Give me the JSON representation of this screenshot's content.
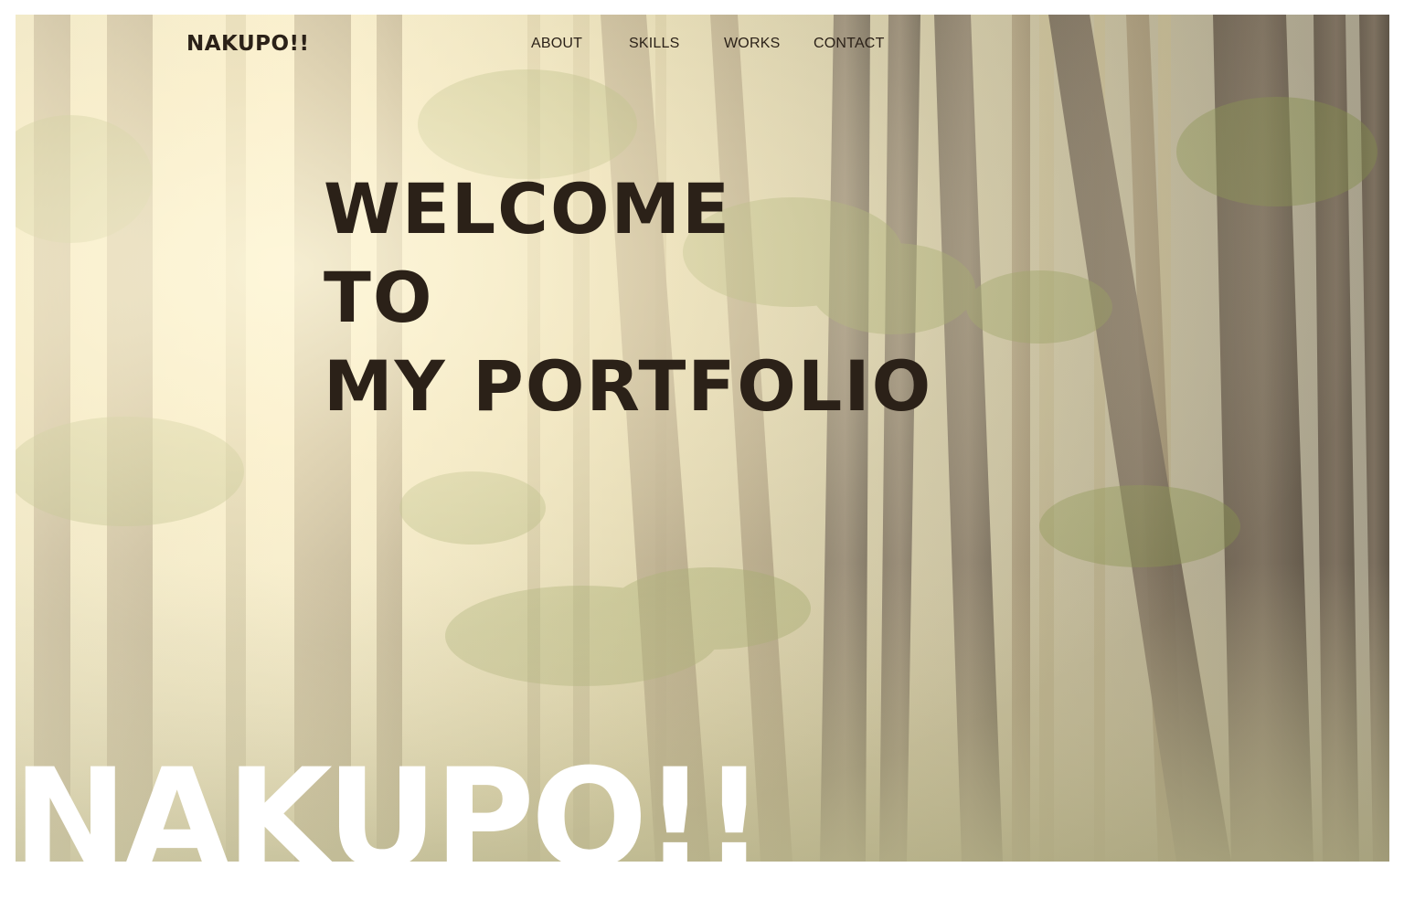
{
  "site": {
    "brand": "NAKUPO!!",
    "big_logo": "NAKUPO!!"
  },
  "nav": {
    "items": [
      {
        "label": "ABOUT"
      },
      {
        "label": "SKILLS"
      },
      {
        "label": "WORKS"
      },
      {
        "label": "CONTACT"
      }
    ]
  },
  "hero": {
    "lines": [
      "WELCOME",
      "TO",
      "MY PORTFOLIO"
    ]
  },
  "theme": {
    "text_color": "#2b2118",
    "big_logo_color": "#ffffff",
    "background_image": "misty-forest-photo"
  }
}
